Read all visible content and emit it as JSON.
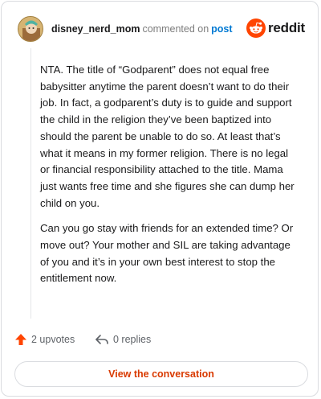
{
  "header": {
    "username": "disney_nerd_mom",
    "commented_text": "commented on",
    "post_link": "post",
    "logo_text": "reddit"
  },
  "comment": {
    "paragraphs": [
      "NTA. The title of “Godparent” does not equal free babysitter anytime the parent doesn’t want to do their job. In fact, a godparent’s duty is to guide and support the child in the religion they’ve been baptized into should the parent be unable to do so. At least that’s what it means in my former religion. There is no legal or financial responsibility attached to the title. Mama just wants free time and she figures she can dump her child on you.",
      "Can you go stay with friends for an extended time? Or move out? Your mother and SIL are taking advantage of you and it’s in your own best interest to stop the entitlement now."
    ]
  },
  "actions": {
    "upvotes_label": "2 upvotes",
    "replies_label": "0 replies"
  },
  "footer": {
    "view_button_label": "View the conversation"
  },
  "colors": {
    "brand": "#ff4500",
    "link": "#0079d3",
    "button_text": "#d93a00"
  },
  "icons": [
    "avatar",
    "reddit-logo-icon",
    "upvote-arrow-icon",
    "reply-arrow-icon"
  ]
}
